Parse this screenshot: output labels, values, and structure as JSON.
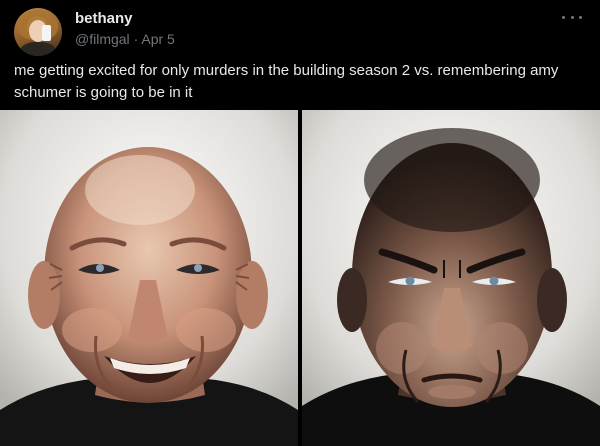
{
  "tweet": {
    "display_name": "bethany",
    "handle": "@filmgal",
    "separator": "·",
    "date": "Apr 5",
    "text": "me getting excited for only murders in the building season 2 vs. remembering amy schumer is going to be in it",
    "more_icon": "ellipsis-horizontal-icon"
  },
  "media": {
    "images": [
      {
        "subject": "grinning bald man portrait"
      },
      {
        "subject": "scowling bald man portrait"
      }
    ]
  },
  "colors": {
    "background": "#000000",
    "text_primary": "#e7e9ea",
    "text_secondary": "#71767b"
  }
}
